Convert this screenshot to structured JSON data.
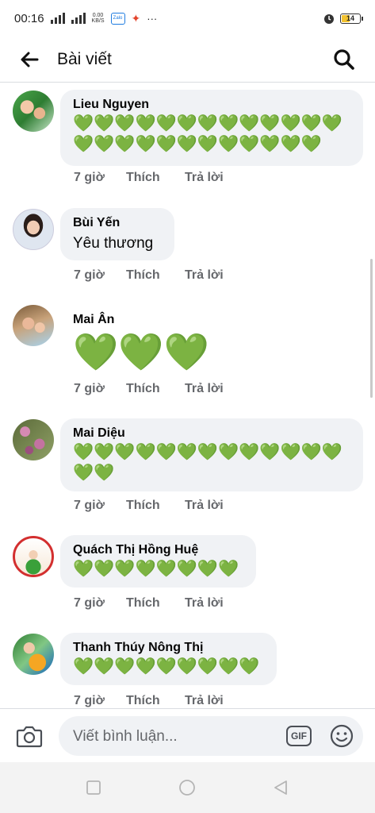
{
  "status_bar": {
    "time": "00:16",
    "net_speed_value": "0.00",
    "net_speed_unit": "KB/S",
    "battery": "14",
    "app_label": "Zalo"
  },
  "header": {
    "title": "Bài viết"
  },
  "comments": [
    {
      "name": "Lieu Nguyen",
      "hearts": "💚💚💚💚💚💚💚💚💚💚💚💚💚💚💚💚💚💚💚💚💚💚💚💚💚",
      "time": "7 giờ",
      "like": "Thích",
      "reply": "Trả lời"
    },
    {
      "name": "Bùi Yến",
      "text": "Yêu thương",
      "time": "7 giờ",
      "like": "Thích",
      "reply": "Trả lời"
    },
    {
      "name": "Mai Ân",
      "hearts": "💚💚💚",
      "time": "7 giờ",
      "like": "Thích",
      "reply": "Trả lời"
    },
    {
      "name": "Mai Diệu",
      "hearts": "💚💚💚💚💚💚💚💚💚💚💚💚💚💚💚",
      "time": "7 giờ",
      "like": "Thích",
      "reply": "Trả lời"
    },
    {
      "name": "Quách Thị Hồng Huệ",
      "hearts": "💚💚💚💚💚💚💚💚",
      "time": "7 giờ",
      "like": "Thích",
      "reply": "Trả lời"
    },
    {
      "name": "Thanh Thúy Nông Thị",
      "hearts": "💚💚💚💚💚💚💚💚💚",
      "time": "7 giờ",
      "like": "Thích",
      "reply": "Trả lời"
    }
  ],
  "composer": {
    "placeholder": "Viết bình luận...",
    "gif_label": "GIF"
  },
  "colors": {
    "heart_green": "#3ec93e",
    "bubble_bg": "#f0f2f5",
    "meta_gray": "#65676b"
  }
}
